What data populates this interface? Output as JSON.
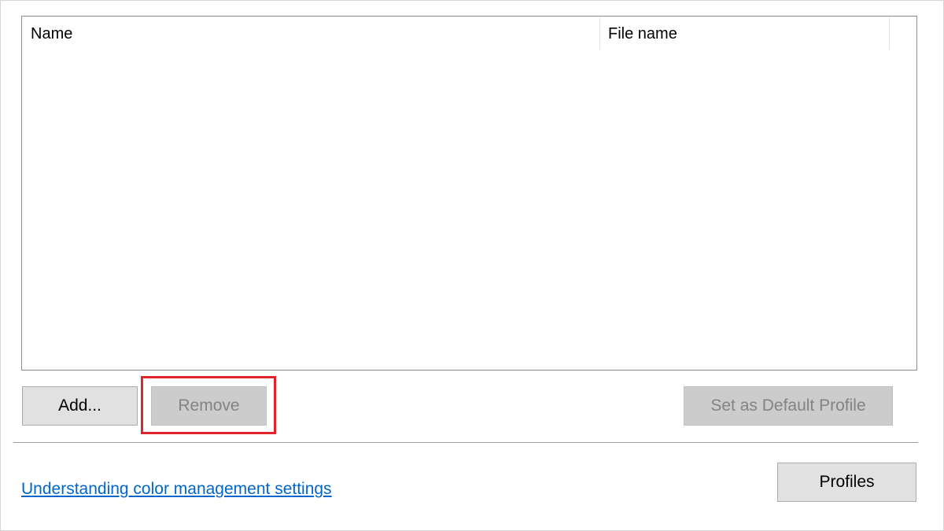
{
  "profiles_list": {
    "columns": [
      {
        "label": "Name"
      },
      {
        "label": "File name"
      }
    ],
    "rows": []
  },
  "buttons": {
    "add": "Add...",
    "remove": "Remove",
    "set_default": "Set as Default Profile",
    "profiles": "Profiles"
  },
  "link": {
    "text": "Understanding color management settings"
  },
  "colors": {
    "highlight_border": "#e0242b",
    "link": "#0066cc"
  }
}
